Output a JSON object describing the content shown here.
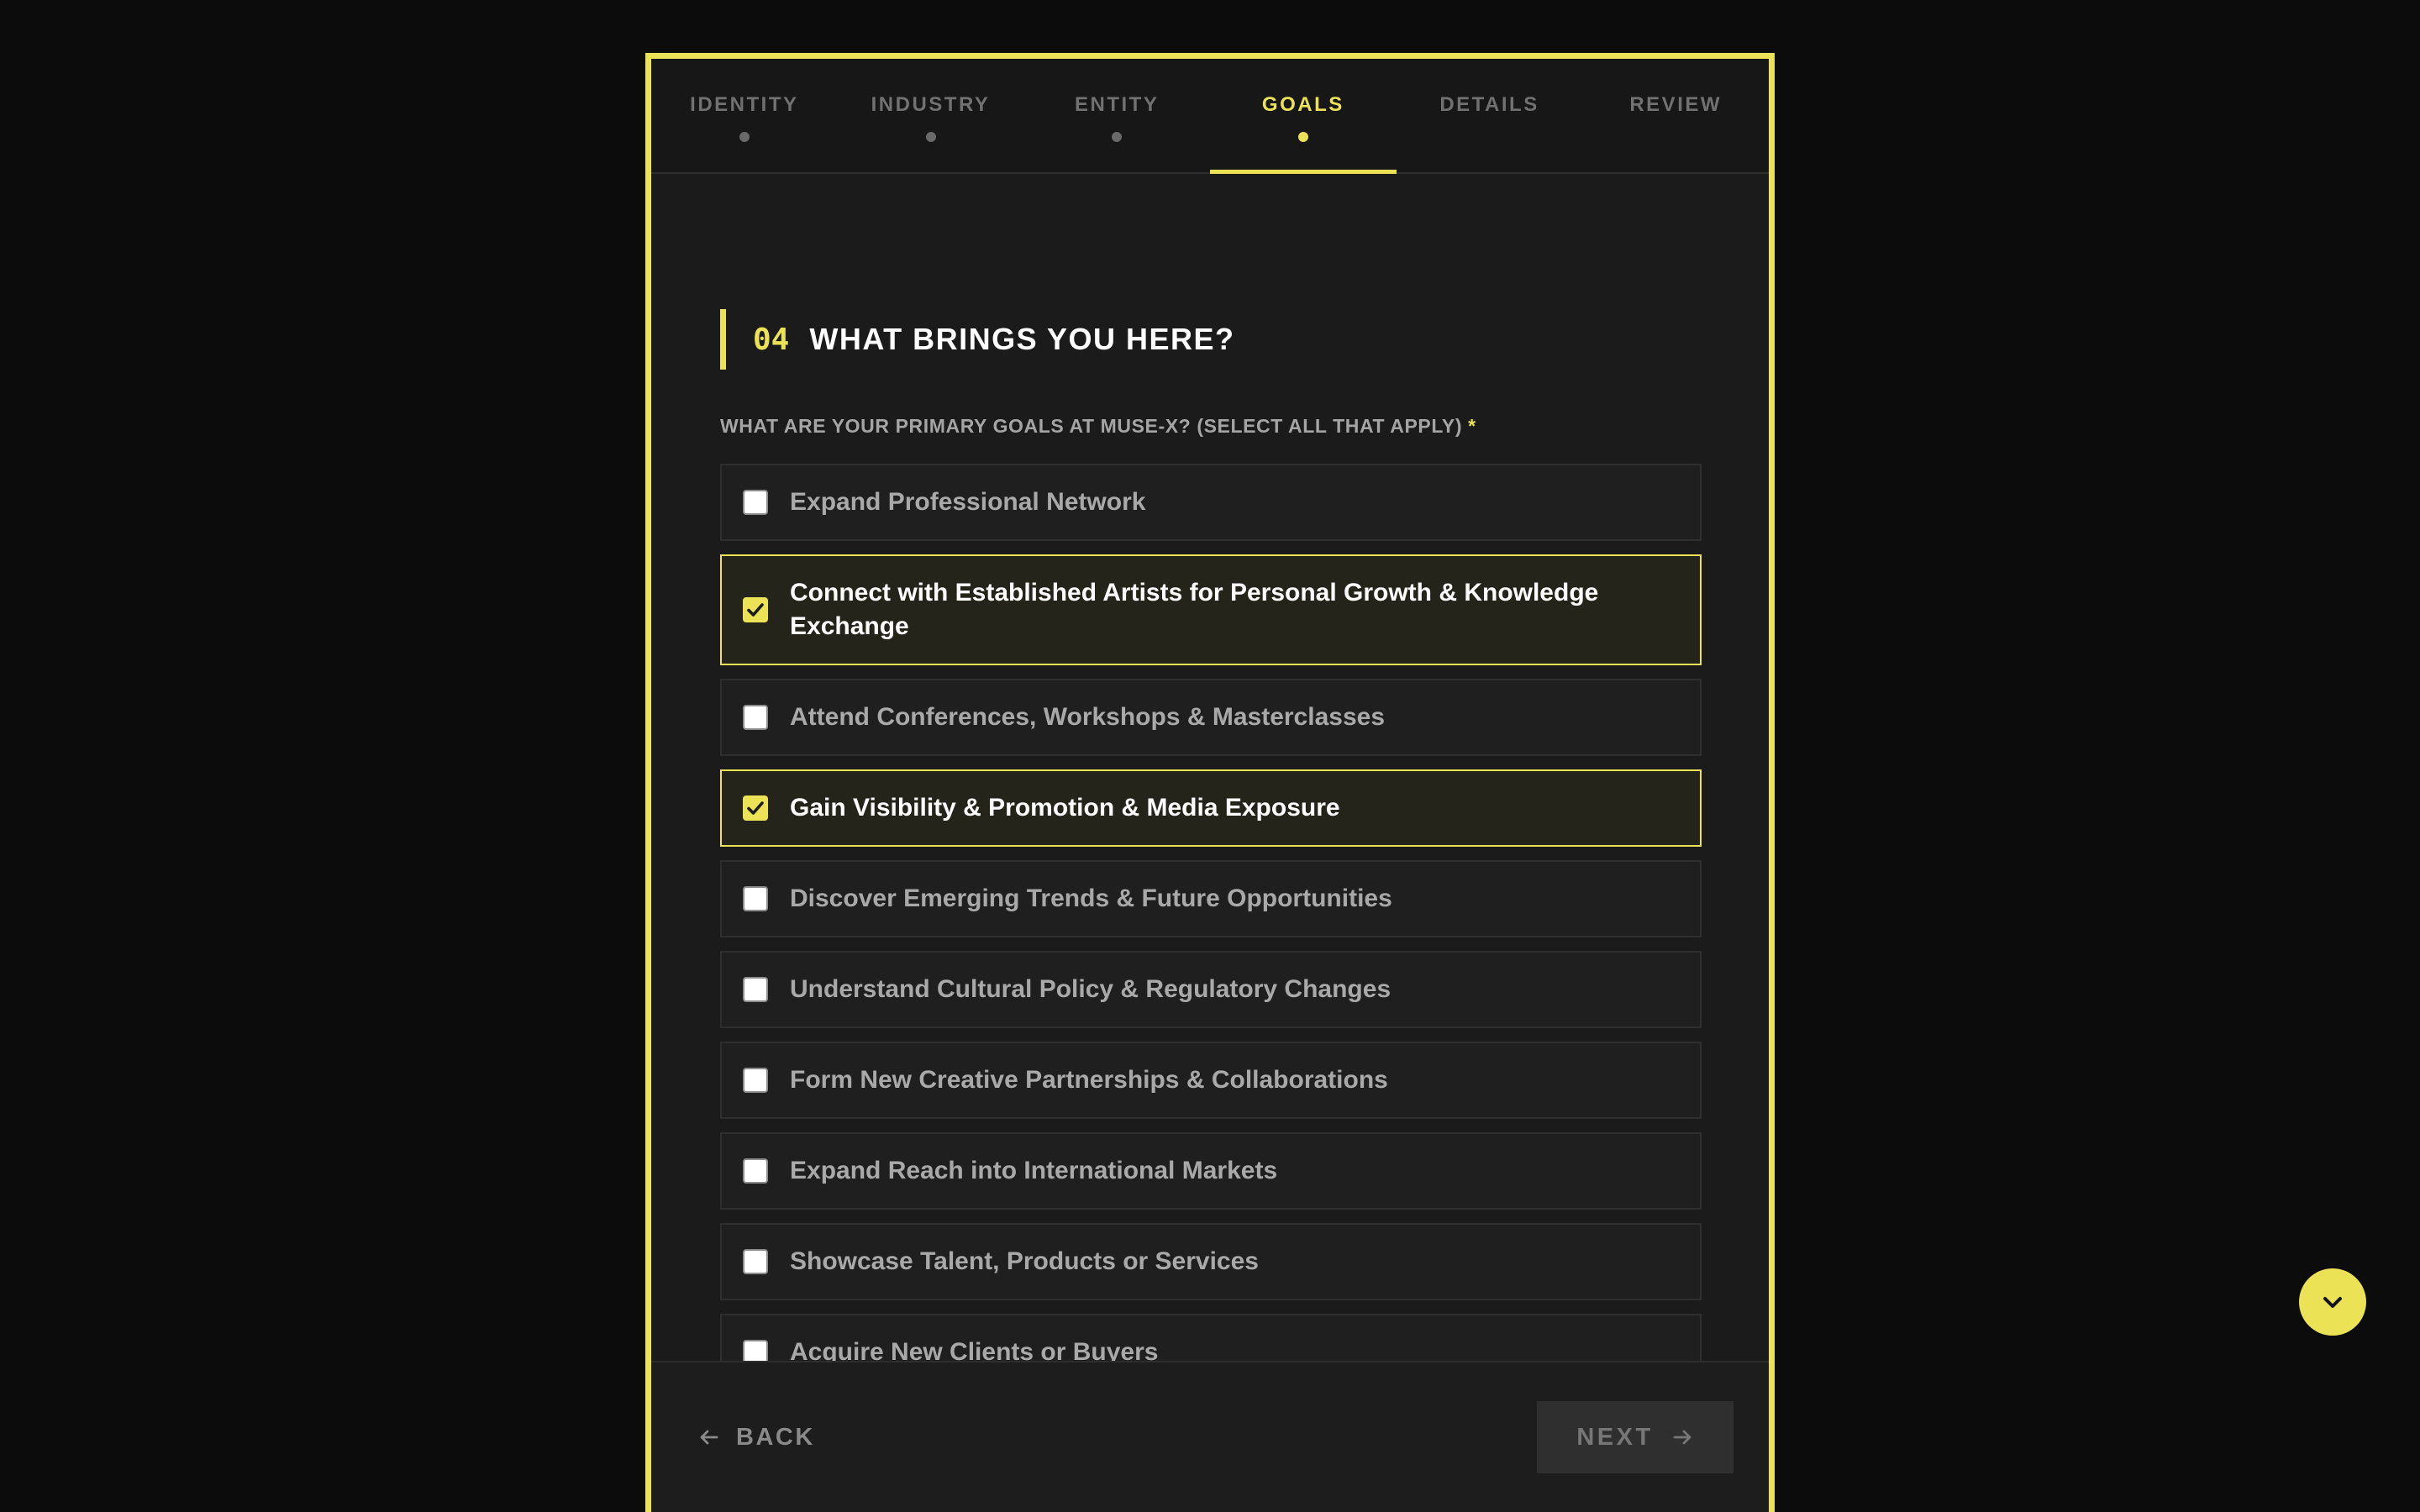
{
  "tabs": [
    {
      "label": "IDENTITY",
      "active": false
    },
    {
      "label": "INDUSTRY",
      "active": false
    },
    {
      "label": "ENTITY",
      "active": false
    },
    {
      "label": "GOALS",
      "active": true
    },
    {
      "label": "DETAILS",
      "active": false
    },
    {
      "label": "REVIEW",
      "active": false
    }
  ],
  "section": {
    "number": "04",
    "title": "WHAT BRINGS YOU HERE?"
  },
  "question": {
    "text": "WHAT ARE YOUR PRIMARY GOALS AT MUSE-X? (SELECT ALL THAT APPLY)",
    "required_marker": "*"
  },
  "options": [
    {
      "label": "Expand Professional Network",
      "checked": false
    },
    {
      "label": "Connect with Established Artists for Personal Growth & Knowledge Exchange",
      "checked": true
    },
    {
      "label": "Attend Conferences, Workshops & Masterclasses",
      "checked": false
    },
    {
      "label": "Gain Visibility & Promotion & Media Exposure",
      "checked": true
    },
    {
      "label": "Discover Emerging Trends & Future Opportunities",
      "checked": false
    },
    {
      "label": "Understand Cultural Policy & Regulatory Changes",
      "checked": false
    },
    {
      "label": "Form New Creative Partnerships & Collaborations",
      "checked": false
    },
    {
      "label": "Expand Reach into International Markets",
      "checked": false
    },
    {
      "label": "Showcase Talent, Products or Services",
      "checked": false
    },
    {
      "label": "Acquire New Clients or Buyers",
      "checked": false
    }
  ],
  "footer": {
    "back_label": "BACK",
    "next_label": "NEXT"
  },
  "colors": {
    "accent": "#ece255",
    "background": "#0c0c0c",
    "panel": "#1b1b1b"
  },
  "icons": {
    "back": "arrow-left-icon",
    "next": "arrow-right-icon",
    "scroll": "chevron-down-icon",
    "check": "checkmark-icon"
  }
}
